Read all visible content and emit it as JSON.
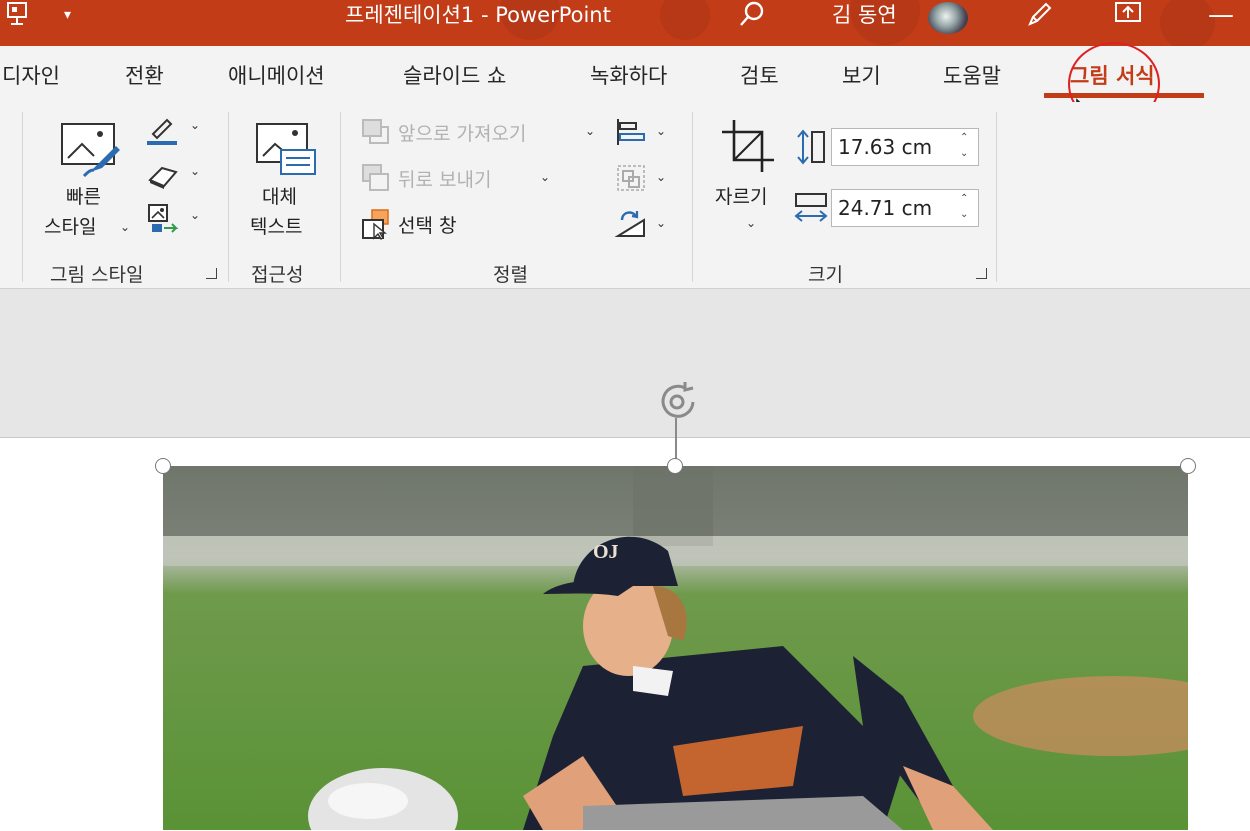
{
  "window": {
    "title": "프레젠테이션1  -  PowerPoint",
    "user_name": "김 동연"
  },
  "tabs": [
    {
      "label": "디자인"
    },
    {
      "label": "전환"
    },
    {
      "label": "애니메이션"
    },
    {
      "label": "슬라이드 쇼"
    },
    {
      "label": "녹화하다"
    },
    {
      "label": "검토"
    },
    {
      "label": "보기"
    },
    {
      "label": "도움말"
    },
    {
      "label": "그림 서식",
      "active": true
    }
  ],
  "ribbon": {
    "picture_styles": {
      "quick_styles_label_1": "빠른",
      "quick_styles_label_2": "스타일",
      "group_label": "그림 스타일"
    },
    "accessibility": {
      "alt_text_label_1": "대체",
      "alt_text_label_2": "텍스트",
      "group_label": "접근성"
    },
    "arrange": {
      "bring_forward": "앞으로 가져오기",
      "send_backward": "뒤로 보내기",
      "selection_pane": "선택 창",
      "group_label": "정렬"
    },
    "size": {
      "crop_label": "자르기",
      "height_value": "17.63 cm",
      "width_value": "24.71 cm",
      "group_label": "크기"
    }
  },
  "colors": {
    "accent": "#c23c18",
    "highlight_circle": "#e02020"
  },
  "icons": [
    "presentation-icon",
    "quick-access-chevron-icon",
    "search-icon",
    "pen-icon",
    "share-icon",
    "rotate-icon"
  ]
}
